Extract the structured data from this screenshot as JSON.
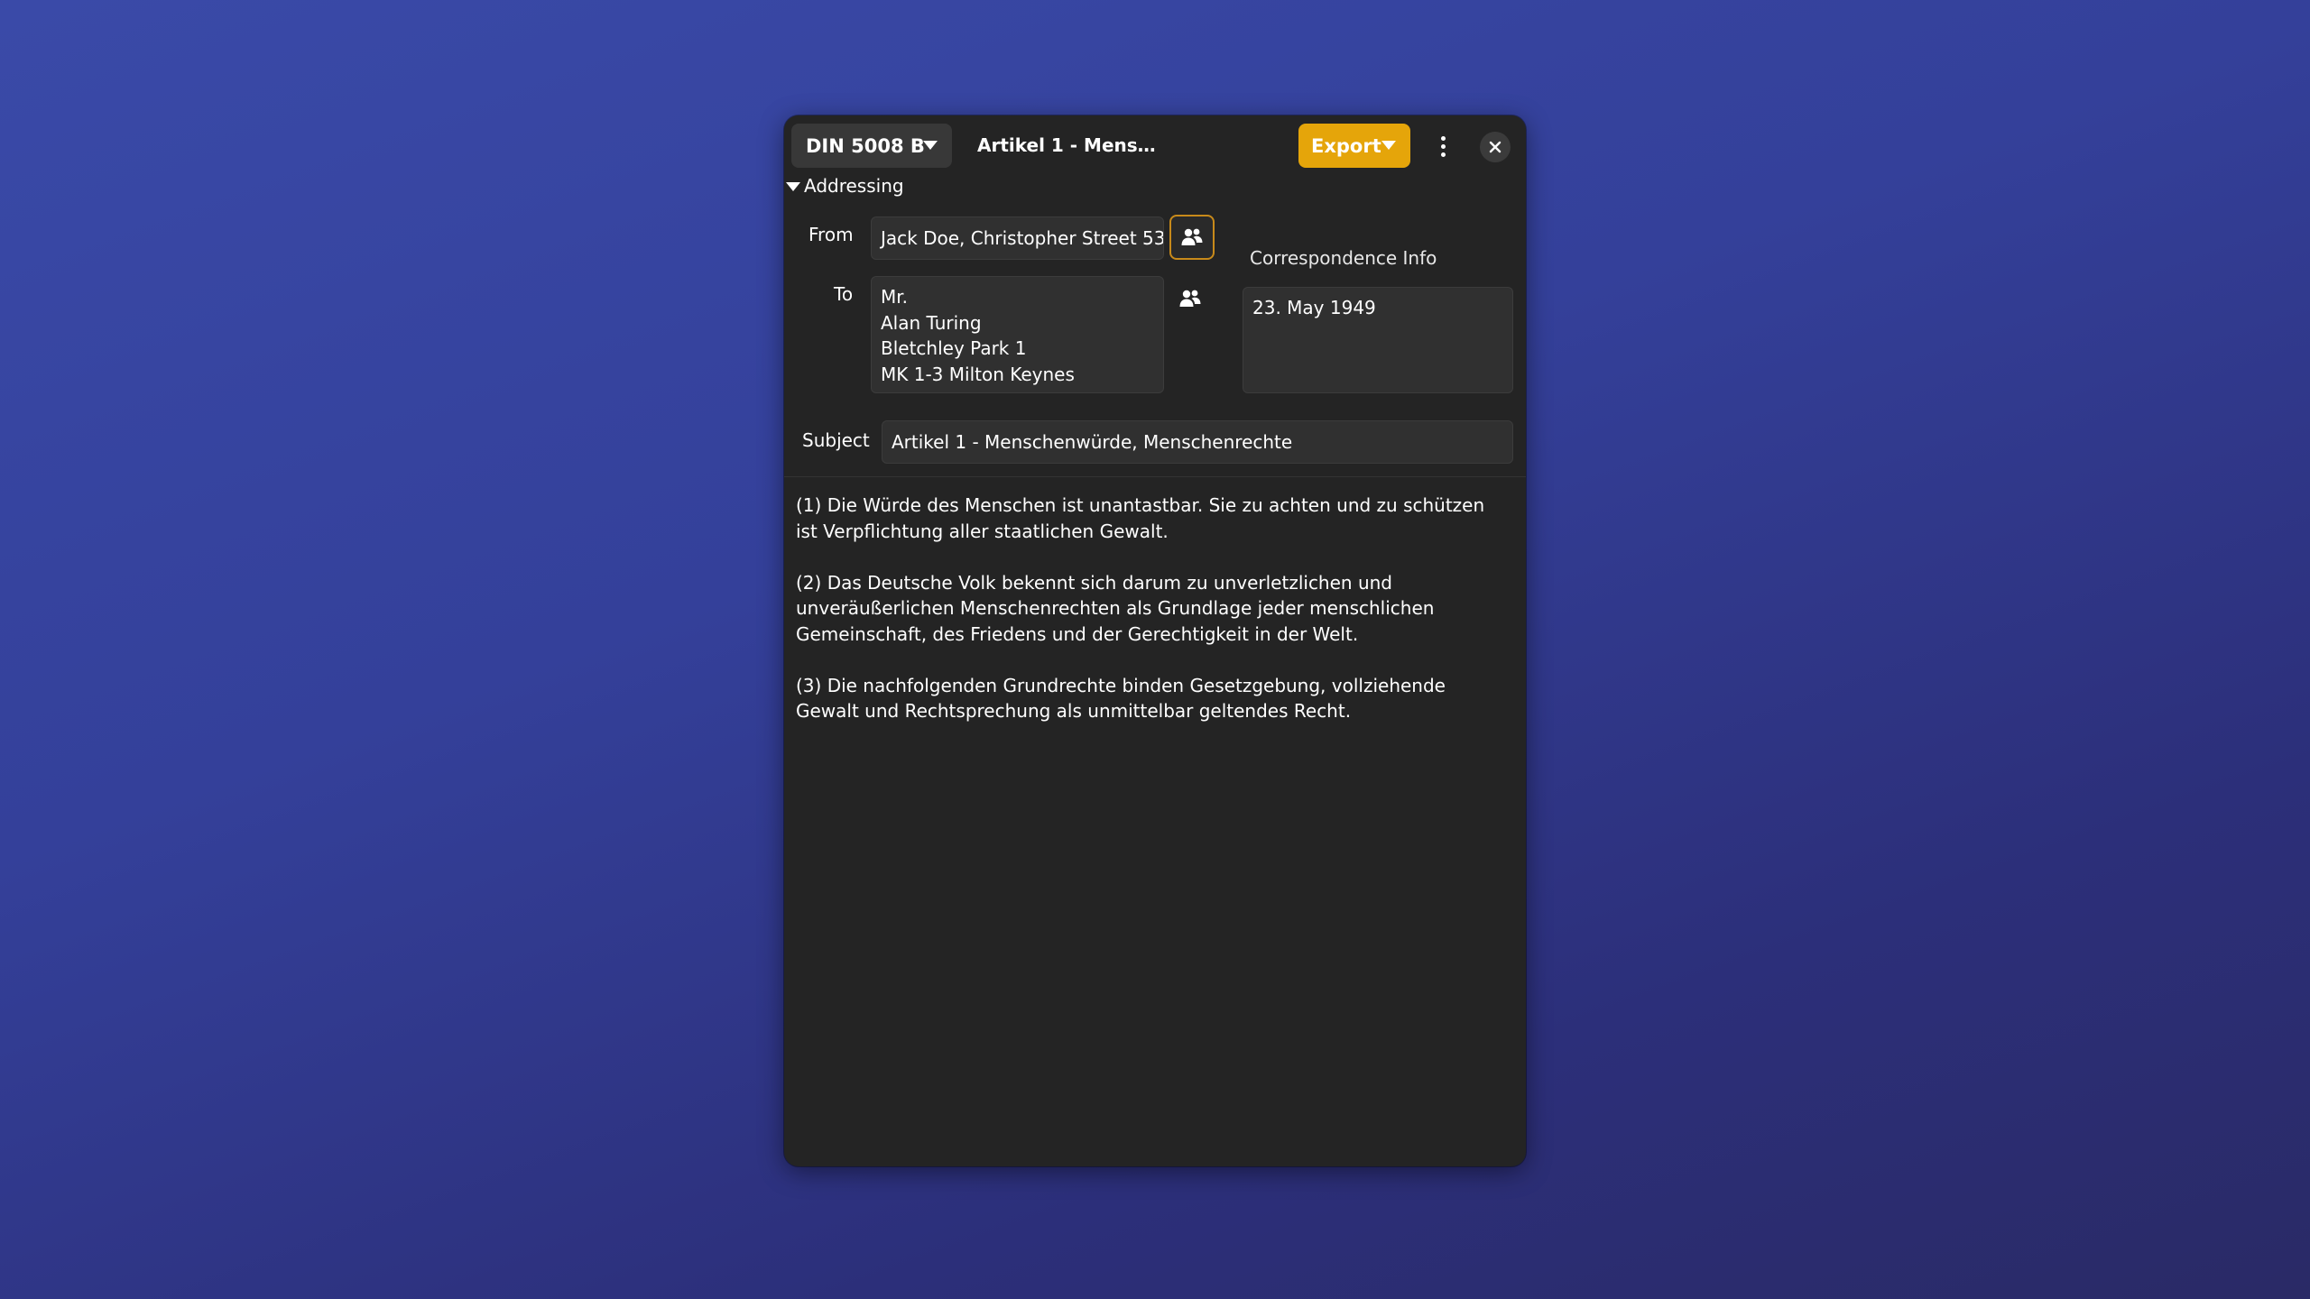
{
  "headerbar": {
    "template_label": "DIN 5008 B",
    "title": "Artikel 1 - Menschenwürde, M...",
    "export_label": "Export"
  },
  "addressing": {
    "expander_label": "Addressing",
    "from_label": "From",
    "from_value": "Jack Doe, Christopher Street 53",
    "to_label": "To",
    "to_lines": [
      "Mr.",
      "Alan Turing",
      "Bletchley Park 1",
      "MK 1-3 Milton Keynes"
    ],
    "correspondence_label": "Correspondence Info",
    "correspondence_value": "23. May 1949",
    "subject_label": "Subject",
    "subject_value": "Artikel 1 - Menschenwürde, Menschenrechte"
  },
  "body": {
    "paragraphs": [
      "(1) Die Würde des Menschen ist unantastbar. Sie zu achten und zu schützen ist Verpflichtung aller staatlichen Gewalt.",
      "(2) Das Deutsche Volk bekennt sich darum zu unverletzlichen und unveräußerlichen Menschenrechten als Grundlage jeder menschlichen Gemeinschaft, des Friedens und der Gerechtigkeit in der Welt.",
      "(3) Die nachfolgenden Grundrechte binden Gesetzgebung, vollziehende Gewalt und Rechtsprechung als unmittelbar geltendes Recht."
    ]
  },
  "icons": {
    "template_caret": "chevron-down-icon",
    "export_caret": "chevron-down-icon",
    "menu": "vertical-dots-icon",
    "close": "close-icon",
    "contacts": "contacts-icon",
    "expander": "expander-arrow-icon"
  },
  "colors": {
    "window_bg": "#242424",
    "accent_export": "#e5a50a",
    "focus_border": "#c88a1a",
    "entry_bg": "#303030"
  }
}
